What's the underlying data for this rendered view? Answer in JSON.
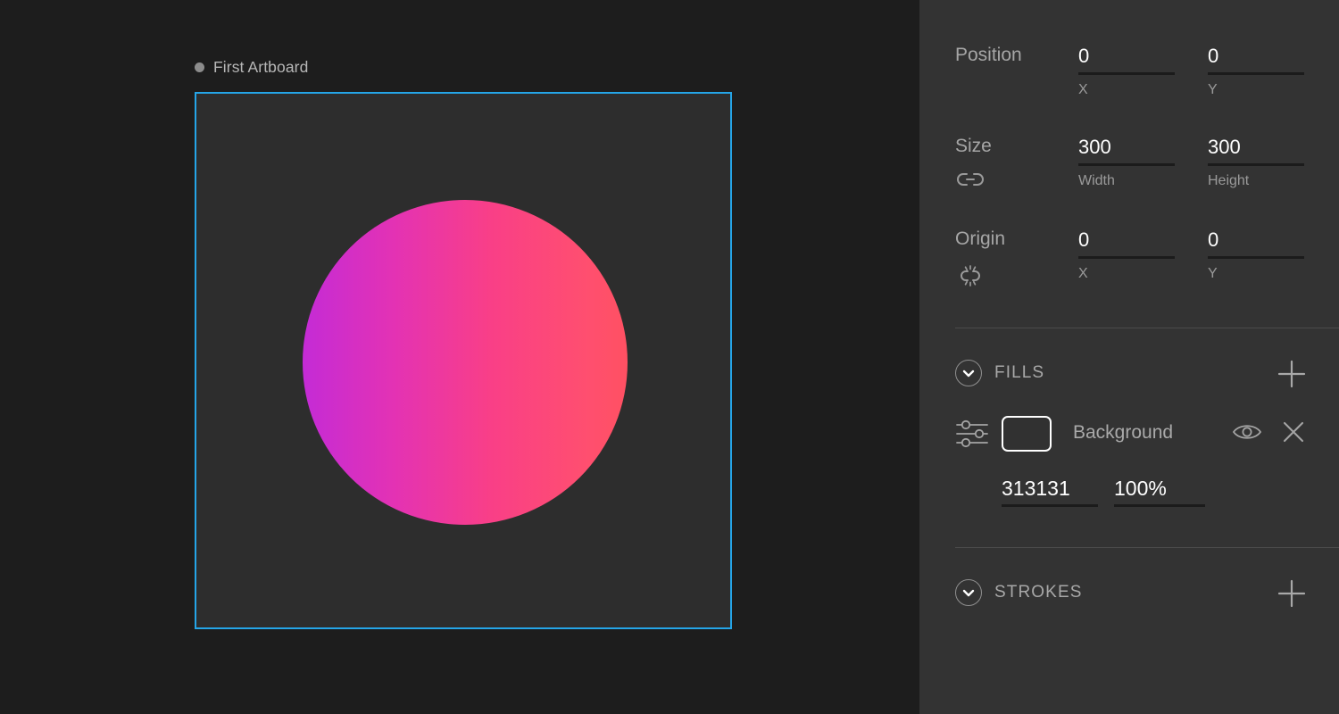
{
  "canvas": {
    "artboard_name": "First Artboard",
    "artboard_border_color": "#25a5e8",
    "artboard_fill_color": "#2d2d2d",
    "background_color": "#1d1d1d",
    "shape": {
      "type": "ellipse",
      "gradient_start": "#c42bd6",
      "gradient_end": "#ff5062"
    }
  },
  "panel": {
    "background_color": "#333333",
    "properties": [
      {
        "label": "Position",
        "icon": "",
        "fields": [
          {
            "value": "0",
            "sub": "X"
          },
          {
            "value": "0",
            "sub": "Y"
          }
        ]
      },
      {
        "label": "Size",
        "icon": "link-icon",
        "fields": [
          {
            "value": "300",
            "sub": "Width"
          },
          {
            "value": "300",
            "sub": "Height"
          }
        ]
      },
      {
        "label": "Origin",
        "icon": "origin-icon",
        "fields": [
          {
            "value": "0",
            "sub": "X"
          },
          {
            "value": "0",
            "sub": "Y"
          }
        ]
      }
    ],
    "fills": {
      "title": "FILLS",
      "add_label": "+",
      "collapse_icon": "chevron-down-icon",
      "items": [
        {
          "name": "Background",
          "swatch_color": "#313131",
          "hex": "313131",
          "opacity": "100%",
          "visible_icon": "eye-icon",
          "remove_icon": "close-icon",
          "options_icon": "sliders-icon"
        }
      ]
    },
    "strokes": {
      "title": "STROKES",
      "add_label": "+",
      "collapse_icon": "chevron-down-icon",
      "items": []
    }
  }
}
